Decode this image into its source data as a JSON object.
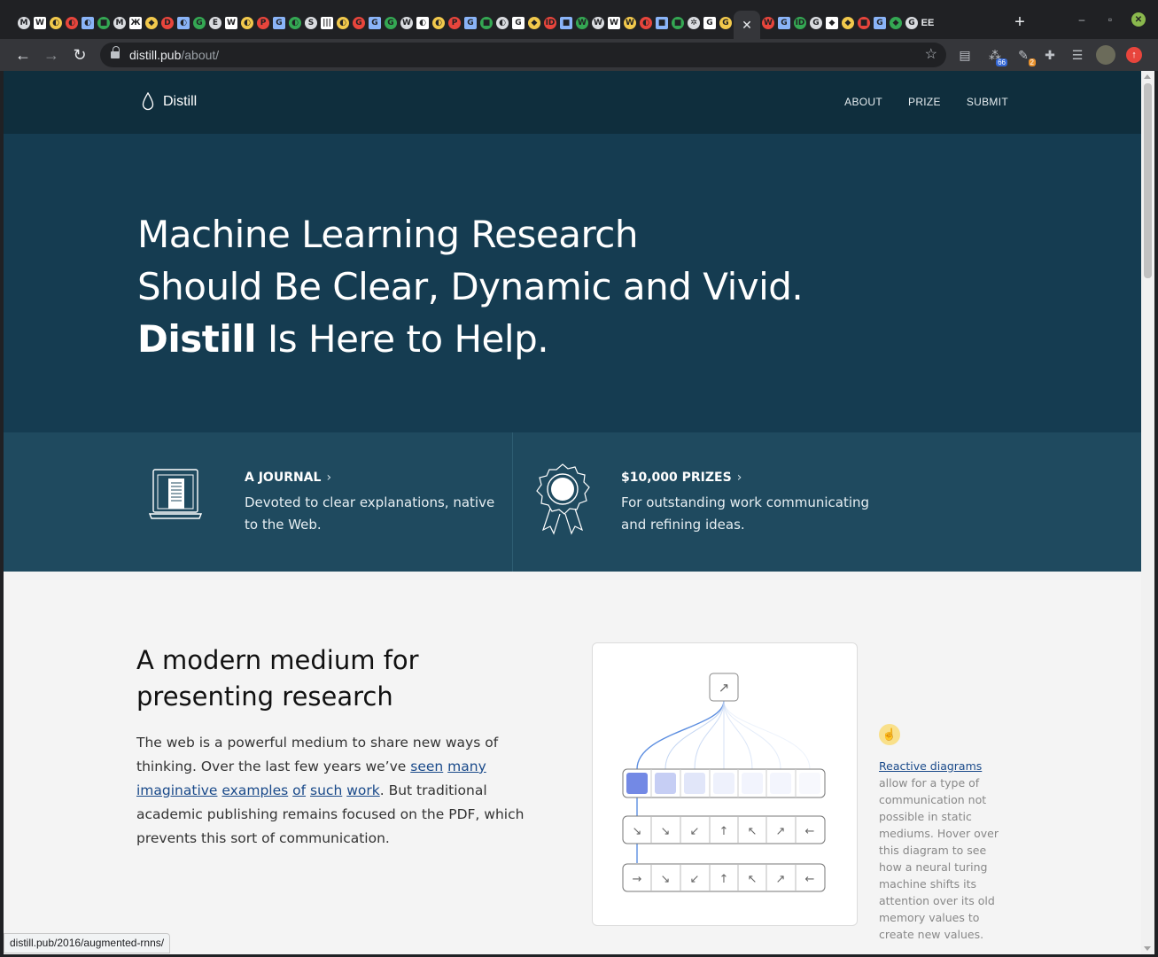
{
  "browser": {
    "favicons": [
      "M",
      "W",
      "◐",
      "◐",
      "◐",
      "■",
      "M",
      "Ж",
      "◆",
      "D",
      "◐",
      "G",
      "E",
      "W",
      "◐",
      "P",
      "G",
      "◐",
      "S",
      "|||",
      "◐",
      "G",
      "G",
      "G",
      "W",
      "◐",
      "◐",
      "P",
      "G",
      "■",
      "◐",
      "G",
      "◆",
      "ID",
      "■",
      "W",
      "W",
      "W",
      "W",
      "◐",
      "■",
      "■",
      "✲",
      "G",
      "G",
      "W",
      "G",
      "ID",
      "G",
      "◆",
      "◆",
      "■",
      "G",
      "◆",
      "G"
    ],
    "active_tab_label": "✕",
    "extra_tab_label": "EE",
    "new_tab": "+",
    "url_host": "distill.pub",
    "url_path": "/about/",
    "extensions": [
      {
        "icon": "doc-icon",
        "glyph": "▤",
        "badge": ""
      },
      {
        "icon": "tree-icon",
        "glyph": "⁂",
        "badge": "66"
      },
      {
        "icon": "gear-icon",
        "glyph": "✎",
        "badge": "2"
      },
      {
        "icon": "puzzle-icon",
        "glyph": "✚",
        "badge": ""
      },
      {
        "icon": "media-icon",
        "glyph": "☰",
        "badge": ""
      }
    ],
    "accent_color": "#8ab84d"
  },
  "site": {
    "brand": "Distill",
    "nav": [
      "ABOUT",
      "PRIZE",
      "SUBMIT"
    ],
    "hero": {
      "line1": "Machine Learning Research",
      "line2": "Should Be Clear, Dynamic and Vivid.",
      "line3_bold": "Distill",
      "line3_rest": " Is Here to Help."
    },
    "features": [
      {
        "title": "A JOURNAL",
        "chevron": "›",
        "desc": "Devoted to clear explanations, native to the Web."
      },
      {
        "title": "$10,000 PRIZES",
        "chevron": "›",
        "desc": "For outstanding work communicating and refining ideas."
      }
    ],
    "section": {
      "heading": "A modern medium for presenting research",
      "p_start": "The web is a powerful medium to share new ways of thinking. Over the last few years we’ve ",
      "links": [
        "seen",
        "many",
        "imaginative",
        "examples",
        "of",
        "such",
        "work"
      ],
      "p_end": ". But traditional academic publishing remains focused on the PDF, which prevents this sort of communication."
    },
    "side_note": {
      "link": "Reactive diagrams",
      "text": " allow for a type of communication not possible in static mediums. Hover over this diagram to see how a neural turing machine shifts its attention over its old memory values to create new values."
    },
    "diagram": {
      "row_arrows": [
        "↘",
        "↘",
        "↙",
        "↑",
        "↖",
        "↗",
        "←"
      ],
      "row2_arrows": [
        "→",
        "↘",
        "↙",
        "↑",
        "↖",
        "↗",
        "←"
      ],
      "memory_opacity": [
        0.85,
        0.35,
        0.18,
        0.1,
        0.08,
        0.07,
        0.05
      ],
      "top_glyph": "↗"
    },
    "colors": {
      "header": "#0f2e3d",
      "hero": "#153c51",
      "features": "#1f4a5f"
    }
  },
  "status_url": "distill.pub/2016/augmented-rnns/"
}
